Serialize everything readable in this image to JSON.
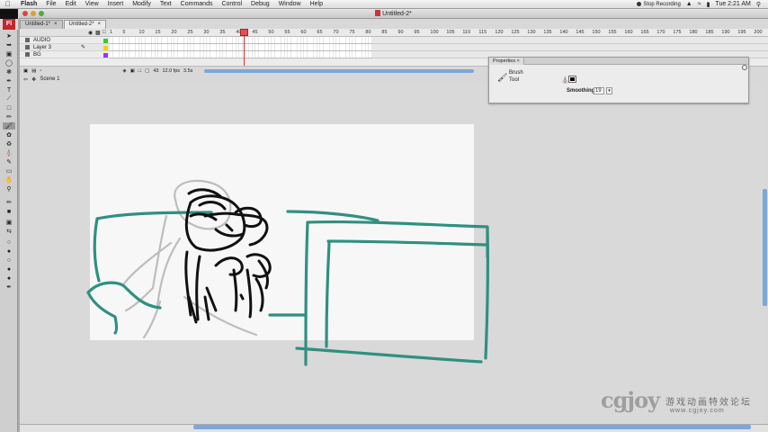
{
  "menubar": {
    "apple": "",
    "items": [
      "Flash",
      "File",
      "Edit",
      "View",
      "Insert",
      "Modify",
      "Text",
      "Commands",
      "Control",
      "Debug",
      "Window",
      "Help"
    ],
    "status_recording": "Stop Recording",
    "clock": "Tue 2:21 AM"
  },
  "window": {
    "title": "Untitled-2*"
  },
  "app_badge": "Fl",
  "doc_tabs": [
    {
      "label": "Untitled-1*",
      "close": "×"
    },
    {
      "label": "Untitled-2*",
      "close": "×"
    }
  ],
  "timeline": {
    "layers": [
      {
        "name": "AUDIO",
        "color": "#33cc33"
      },
      {
        "name": "Layer 3",
        "color": "#ffcc00"
      },
      {
        "name": "BG",
        "color": "#9933ff"
      }
    ],
    "frame_numbers": [
      "1",
      "5",
      "10",
      "15",
      "20",
      "25",
      "30",
      "35",
      "40",
      "45",
      "50",
      "55",
      "60",
      "65",
      "70",
      "75",
      "80",
      "85",
      "90",
      "95",
      "100",
      "105",
      "110",
      "115",
      "120",
      "125",
      "130",
      "135",
      "140",
      "145",
      "150",
      "155",
      "160",
      "165",
      "170",
      "175",
      "180",
      "185",
      "190",
      "195",
      "200"
    ],
    "current_frame": "43",
    "fps": "12.0 fps",
    "time": "3.5s"
  },
  "scene": {
    "label": "Scene 1"
  },
  "properties": {
    "tab": "Properties",
    "tool_line1": "Brush",
    "tool_line2": "Tool",
    "smoothing_label": "Smoothing:",
    "smoothing_value": "19",
    "dropdown_glyph": "▾"
  },
  "watermark": {
    "logo": "cgjoy",
    "chinese": "游戏动画特效论坛",
    "url": "www.cgjoy.com"
  },
  "colors": {
    "teal_stroke": "#2f9080",
    "sketch_gray": "#bdbdbd",
    "ink": "#111111",
    "accent_blue": "#7da7d9"
  }
}
